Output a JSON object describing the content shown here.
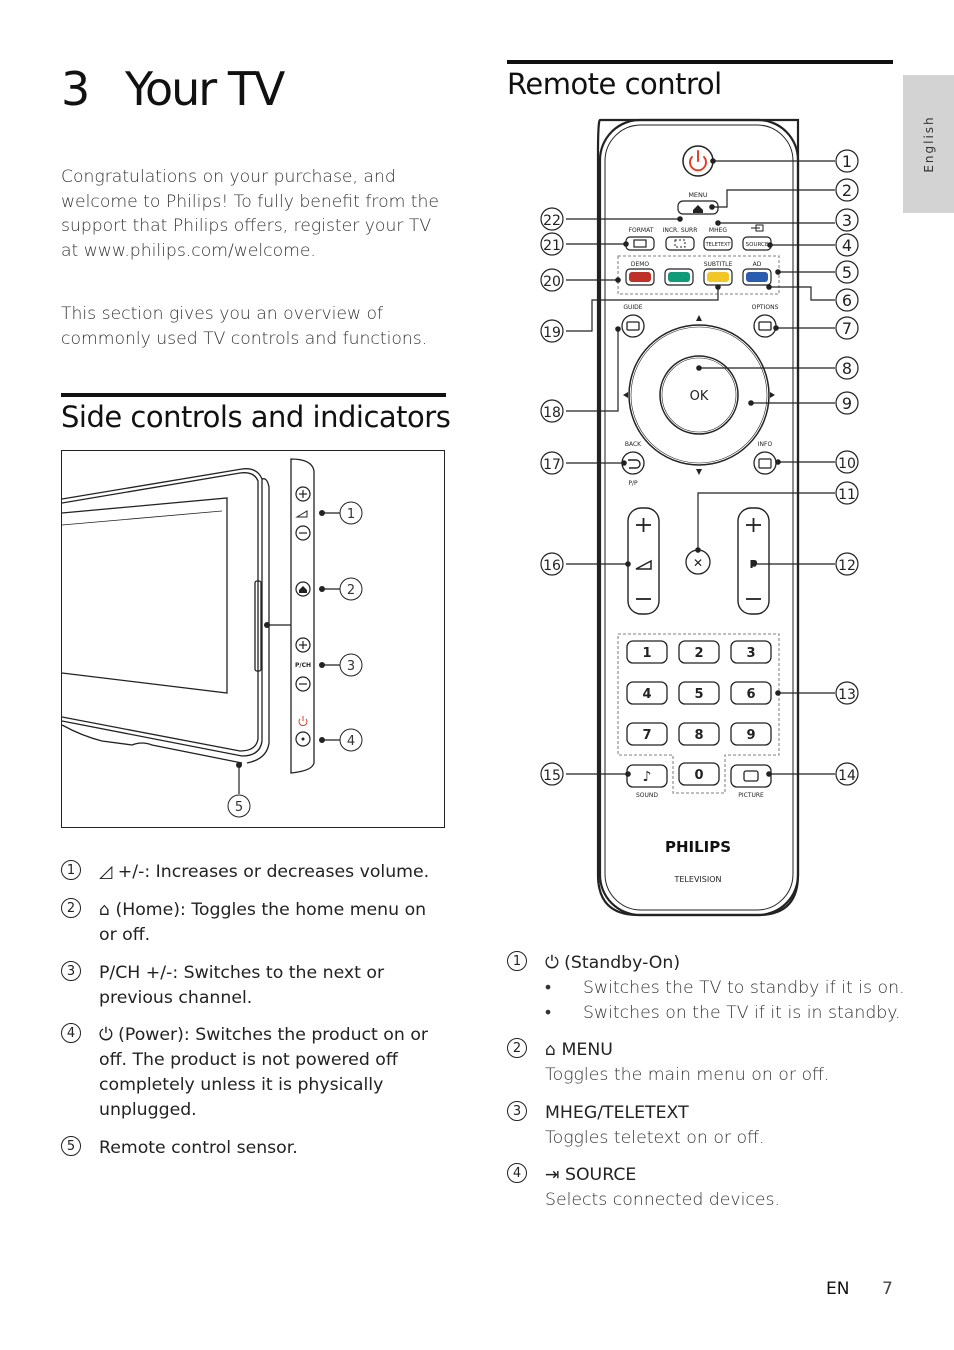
{
  "chapter": {
    "number": "3",
    "title": "Your TV"
  },
  "intro": {
    "paragraph1": "Congratulations on your purchase, and welcome to Philips! To fully benefit from the support that Philips offers, register your TV at www.philips.com/welcome.",
    "paragraph2": "This section gives you an overview of commonly used TV controls and functions."
  },
  "side_controls": {
    "heading": "Side controls and indicators",
    "figure": {
      "callouts": [
        "1",
        "2",
        "3",
        "4",
        "5"
      ],
      "panel_label_pch": "P/CH"
    },
    "items": [
      {
        "num": "1",
        "icon": "volume-icon",
        "icon_glyph": "◿",
        "text": "+/-: Increases or decreases volume."
      },
      {
        "num": "2",
        "icon": "home-icon",
        "icon_glyph": "⌂",
        "text": "(Home): Toggles the home menu on or off."
      },
      {
        "num": "3",
        "icon": "",
        "icon_glyph": "",
        "text": "P/CH +/-: Switches to the next or previous channel."
      },
      {
        "num": "4",
        "icon": "power-icon",
        "icon_glyph": "⏻",
        "text": "(Power): Switches the product on or off. The product is not powered off completely unless it is physically unplugged."
      },
      {
        "num": "5",
        "icon": "",
        "icon_glyph": "",
        "text": "Remote control sensor."
      }
    ]
  },
  "remote_control": {
    "heading": "Remote control",
    "figure": {
      "labels": {
        "menu": "MENU",
        "format": "FORMAT",
        "incr_surr": "INCR. SURR",
        "mheg": "MHEG",
        "teletext": "TELETEXT",
        "source": "SOURCE",
        "demo": "DEMO",
        "subtitle": "SUBTITLE",
        "ad": "AD",
        "guide": "GUIDE",
        "options": "OPTIONS",
        "ok": "OK",
        "back": "BACK",
        "pp": "P/P",
        "info": "INFO",
        "p": "P",
        "sound": "SOUND",
        "picture": "PICTURE",
        "brand": "PHILIPS",
        "subbrand": "TELEVISION"
      },
      "digits": [
        "1",
        "2",
        "3",
        "4",
        "5",
        "6",
        "7",
        "8",
        "9",
        "0"
      ],
      "color_buttons": {
        "red": "#c0302a",
        "green": "#0f9a78",
        "yellow": "#f2c625",
        "blue": "#2a5cb0"
      },
      "power_color": "#e2402a",
      "callouts_right": [
        "1",
        "2",
        "3",
        "4",
        "5",
        "6",
        "7",
        "8",
        "9",
        "10",
        "11",
        "12",
        "13",
        "14"
      ],
      "callouts_left": [
        "22",
        "21",
        "20",
        "19",
        "18",
        "17",
        "16",
        "15"
      ]
    },
    "items": [
      {
        "num": "1",
        "icon": "power-icon",
        "icon_glyph": "⏻",
        "title": "(Standby-On)",
        "bullets": [
          "Switches the TV to standby if it is on.",
          "Switches on the TV if it is in standby."
        ]
      },
      {
        "num": "2",
        "icon": "home-icon",
        "icon_glyph": "⌂",
        "title": "MENU",
        "desc": "Toggles the main menu on or off."
      },
      {
        "num": "3",
        "icon": "",
        "icon_glyph": "",
        "title": "MHEG/TELETEXT",
        "desc": "Toggles teletext on or off."
      },
      {
        "num": "4",
        "icon": "source-icon",
        "icon_glyph": "⇥",
        "title": "SOURCE",
        "desc": "Selects connected devices."
      }
    ]
  },
  "language_tab": "English",
  "footer": {
    "lang": "EN",
    "page": "7"
  }
}
